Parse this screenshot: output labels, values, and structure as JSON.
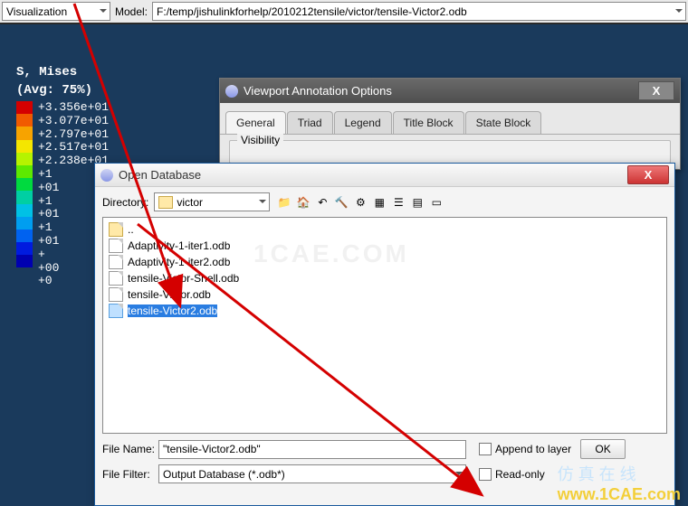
{
  "toolbar": {
    "mode": "Visualization",
    "model_label": "Model:",
    "model_path": "F:/temp/jishulinkforhelp/2010212tensile/victor/tensile-Victor2.odb"
  },
  "legend": {
    "title1": "S, Mises",
    "title2": "(Avg: 75%)",
    "values": [
      "+3.356e+01",
      "+3.077e+01",
      "+2.797e+01",
      "+2.517e+01",
      "+2.238e+01",
      "+1",
      "     +01",
      "+1",
      "     +01",
      "+1",
      "     +01",
      "+",
      "     +00",
      "+0"
    ],
    "colors": [
      "#d40000",
      "#f15a00",
      "#f7a300",
      "#f4e600",
      "#b6f300",
      "#5de900",
      "#00da3f",
      "#00cfa3",
      "#00c1e5",
      "#009ef0",
      "#0062f0",
      "#001bdf",
      "#0000b0"
    ]
  },
  "vao_dialog": {
    "title": "Viewport Annotation Options",
    "close": "X",
    "tabs": [
      "General",
      "Triad",
      "Legend",
      "Title Block",
      "State Block"
    ],
    "active_tab": 0,
    "group_label": "Visibility"
  },
  "open_db": {
    "title": "Open Database",
    "close": "X",
    "directory_label": "Directory:",
    "directory_value": "victor",
    "tool_icons": [
      "folder-back",
      "home",
      "tool",
      "hammer",
      "options",
      "grid1",
      "list",
      "grid2",
      "details"
    ],
    "files": [
      {
        "name": "..",
        "type": "folder"
      },
      {
        "name": "Adaptivity-1-iter1.odb",
        "type": "file"
      },
      {
        "name": "Adaptivity-1-iter2.odb",
        "type": "file"
      },
      {
        "name": "tensile-Victor-Shell.odb",
        "type": "file"
      },
      {
        "name": "tensile-Victor.odb",
        "type": "file"
      },
      {
        "name": "tensile-Victor2.odb",
        "type": "file",
        "selected": true
      }
    ],
    "filename_label": "File Name:",
    "filename_value": "\"tensile-Victor2.odb\"",
    "filter_label": "File Filter:",
    "filter_value": "Output Database (*.odb*)",
    "append_label": "Append to layer",
    "readonly_label": "Read-only",
    "ok_label": "OK"
  },
  "watermark": {
    "cn": "仿 真 在 线",
    "url": "www.1CAE.com"
  },
  "faint_mark": "1CAE.COM"
}
